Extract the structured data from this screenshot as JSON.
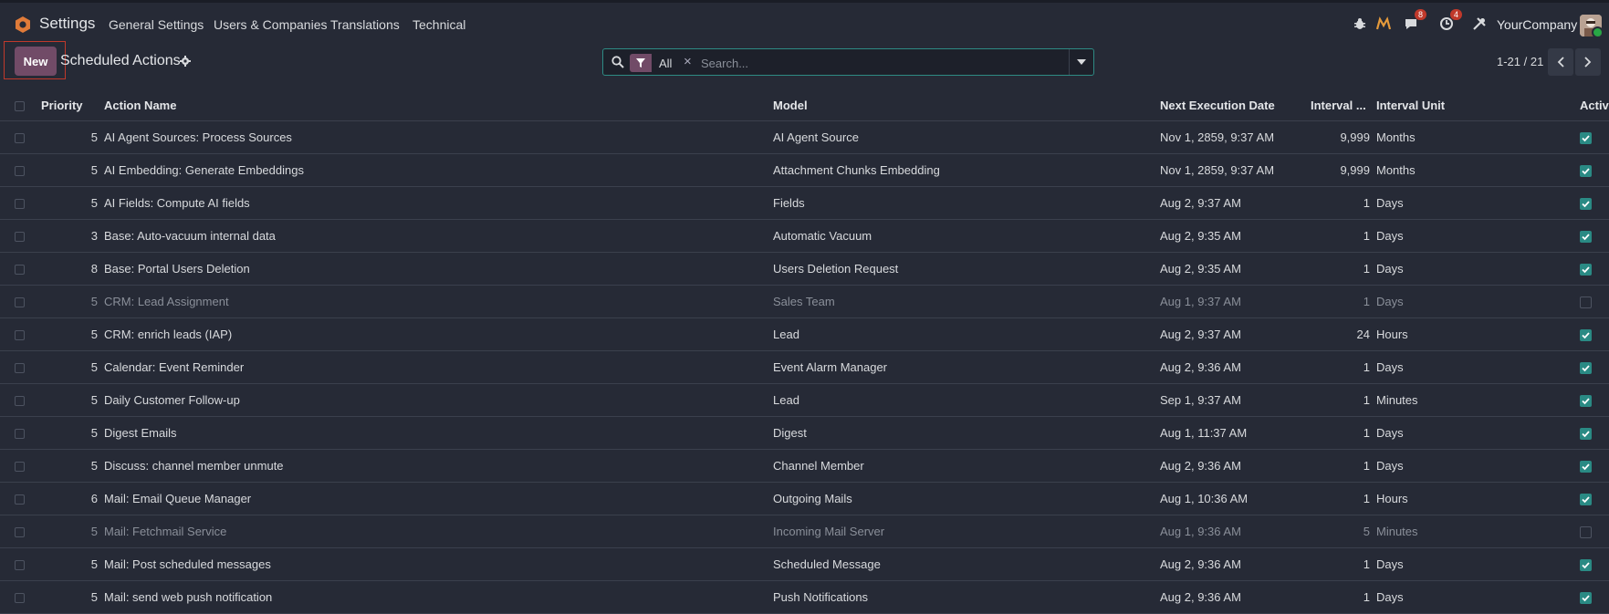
{
  "topbar": {
    "app_name": "Settings",
    "menu": [
      "General Settings",
      "Users & Companies",
      "Translations",
      "Technical"
    ],
    "messages_count": "8",
    "activities_count": "4",
    "company": "YourCompany"
  },
  "control": {
    "new_label": "New",
    "title": "Scheduled Actions",
    "search": {
      "facet": "All",
      "placeholder": "Search..."
    },
    "pager": "1-21 / 21"
  },
  "columns": {
    "priority": "Priority",
    "action_name": "Action Name",
    "model": "Model",
    "next_execution": "Next Execution Date",
    "interval_number": "Interval ...",
    "interval_unit": "Interval Unit",
    "active": "Activ"
  },
  "rows": [
    {
      "priority": "5",
      "name": "AI Agent Sources: Process Sources",
      "model": "AI Agent Source",
      "next": "Nov 1, 2859, 9:37 AM",
      "interval": "9,999",
      "unit": "Months",
      "active": true
    },
    {
      "priority": "5",
      "name": "AI Embedding: Generate Embeddings",
      "model": "Attachment Chunks Embedding",
      "next": "Nov 1, 2859, 9:37 AM",
      "interval": "9,999",
      "unit": "Months",
      "active": true
    },
    {
      "priority": "5",
      "name": "AI Fields: Compute AI fields",
      "model": "Fields",
      "next": "Aug 2, 9:37 AM",
      "interval": "1",
      "unit": "Days",
      "active": true
    },
    {
      "priority": "3",
      "name": "Base: Auto-vacuum internal data",
      "model": "Automatic Vacuum",
      "next": "Aug 2, 9:35 AM",
      "interval": "1",
      "unit": "Days",
      "active": true
    },
    {
      "priority": "8",
      "name": "Base: Portal Users Deletion",
      "model": "Users Deletion Request",
      "next": "Aug 2, 9:35 AM",
      "interval": "1",
      "unit": "Days",
      "active": true
    },
    {
      "priority": "5",
      "name": "CRM: Lead Assignment",
      "model": "Sales Team",
      "next": "Aug 1, 9:37 AM",
      "interval": "1",
      "unit": "Days",
      "active": false
    },
    {
      "priority": "5",
      "name": "CRM: enrich leads (IAP)",
      "model": "Lead",
      "next": "Aug 2, 9:37 AM",
      "interval": "24",
      "unit": "Hours",
      "active": true
    },
    {
      "priority": "5",
      "name": "Calendar: Event Reminder",
      "model": "Event Alarm Manager",
      "next": "Aug 2, 9:36 AM",
      "interval": "1",
      "unit": "Days",
      "active": true
    },
    {
      "priority": "5",
      "name": "Daily Customer Follow-up",
      "model": "Lead",
      "next": "Sep 1, 9:37 AM",
      "interval": "1",
      "unit": "Minutes",
      "active": true
    },
    {
      "priority": "5",
      "name": "Digest Emails",
      "model": "Digest",
      "next": "Aug 1, 11:37 AM",
      "interval": "1",
      "unit": "Days",
      "active": true
    },
    {
      "priority": "5",
      "name": "Discuss: channel member unmute",
      "model": "Channel Member",
      "next": "Aug 2, 9:36 AM",
      "interval": "1",
      "unit": "Days",
      "active": true
    },
    {
      "priority": "6",
      "name": "Mail: Email Queue Manager",
      "model": "Outgoing Mails",
      "next": "Aug 1, 10:36 AM",
      "interval": "1",
      "unit": "Hours",
      "active": true
    },
    {
      "priority": "5",
      "name": "Mail: Fetchmail Service",
      "model": "Incoming Mail Server",
      "next": "Aug 1, 9:36 AM",
      "interval": "5",
      "unit": "Minutes",
      "active": false
    },
    {
      "priority": "5",
      "name": "Mail: Post scheduled messages",
      "model": "Scheduled Message",
      "next": "Aug 2, 9:36 AM",
      "interval": "1",
      "unit": "Days",
      "active": true
    },
    {
      "priority": "5",
      "name": "Mail: send web push notification",
      "model": "Push Notifications",
      "next": "Aug 2, 9:36 AM",
      "interval": "1",
      "unit": "Days",
      "active": true
    }
  ]
}
